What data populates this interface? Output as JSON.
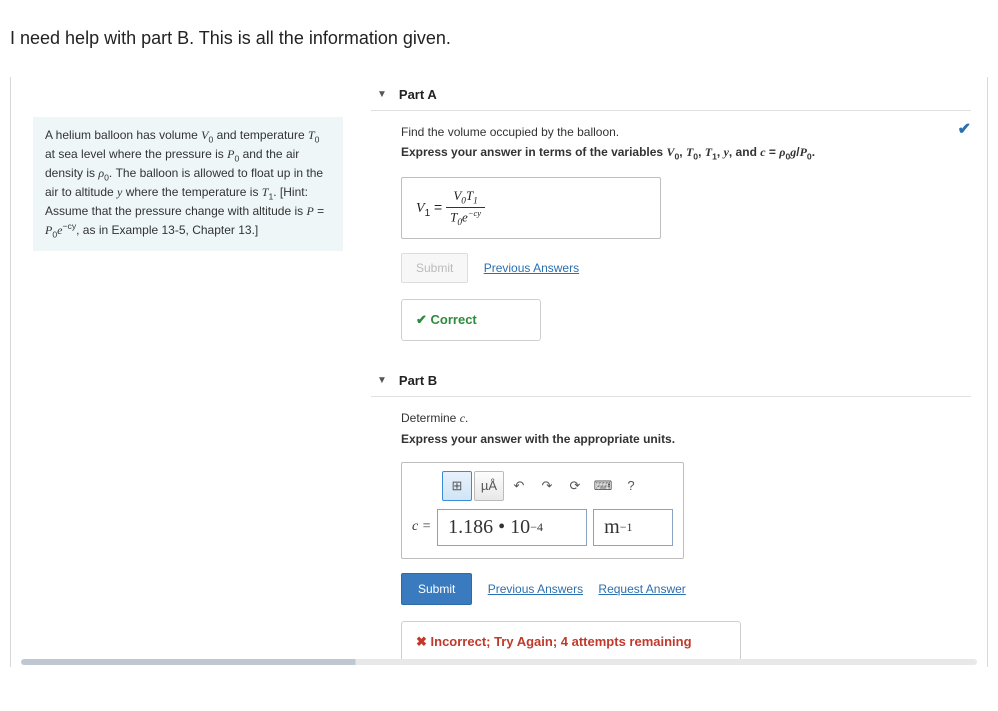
{
  "page_heading": "I need help with part B. This is all the information given.",
  "problem_statement_html": "A helium balloon has volume <span class='it'>V</span><sub>0</sub> and temperature <span class='it'>T</span><sub>0</sub> at sea level where the pressure is <span class='it'>P</span><sub>0</sub> and the air density is <span class='it'>ρ</span><sub>0</sub>. The balloon is allowed to float up in the air to altitude <span class='it'>y</span> where the temperature is <span class='it'>T</span><sub>1</sub>. [Hint: Assume that the pressure change with altitude is <span class='it'>P</span> = <span class='it'>P</span><sub>0</sub><span class='it'>e</span><sup>−cy</sup>, as in Example 13-5, Chapter 13.]",
  "partA": {
    "label": "Part A",
    "instruction1": "Find the volume occupied by the balloon.",
    "instruction2_html": "Express your answer in terms of the variables <span class='it'>V</span><sub>0</sub>, <span class='it'>T</span><sub>0</sub>, <span class='it'>T</span><sub>1</sub>, <span class='it'>y</span>, and <span class='it'>c</span> = <span class='it'>ρ</span><sub>0</sub><span class='it'>g</span>/<span class='it'>P</span><sub>0</sub>.",
    "answer_lhs_html": "<span class='it'>V</span><sub>1</sub> = ",
    "answer_numerator_html": "<span class='it'>V</span><sub>0</sub><span class='it'>T</span><sub>1</sub>",
    "answer_denominator_html": "<span class='it'>T</span><sub>0</sub><span class='it'>e</span><sup style='font-size:0.65em'>−cy</sup>",
    "submit_label": "Submit",
    "prev_answers_label": "Previous Answers",
    "feedback": "Correct",
    "corner_check": "✔"
  },
  "partB": {
    "label": "Part B",
    "instruction1_html": "Determine <span class='it'>c</span>.",
    "instruction2": "Express your answer with the appropriate units.",
    "toolbar": {
      "templates": "⊞",
      "units_html": "µÅ",
      "undo": "↶",
      "redo": "↷",
      "reset": "⟳",
      "keyboard": "⌨",
      "help": "?"
    },
    "clabel_html": "<span class='it'>c</span> =",
    "value_html": "1.186 • 10<sup style='font-size:0.6em'>−4</sup>",
    "unit_html": "m<sup style='font-size:0.6em'>−1</sup>",
    "submit_label": "Submit",
    "prev_answers_label": "Previous Answers",
    "request_answer_label": "Request Answer",
    "feedback": "Incorrect; Try Again; 4 attempts remaining"
  }
}
